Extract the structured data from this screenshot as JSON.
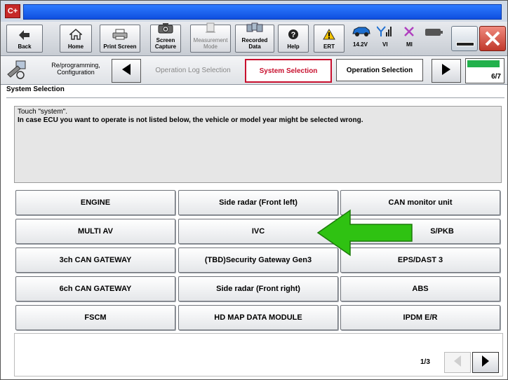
{
  "titlebar": {
    "app_icon_text": "C+"
  },
  "toolbar": {
    "back": "Back",
    "home": "Home",
    "print_screen": "Print Screen",
    "screen_capture": "Screen Capture",
    "measurement_mode": "Measurement Mode",
    "recorded_data": "Recorded Data",
    "help": "Help",
    "ert": "ERT",
    "voltage": "14.2V",
    "vi": "VI",
    "mi": "MI"
  },
  "nav": {
    "reprogramming": "Re/programming, Configuration",
    "step_operation_log": "Operation Log Selection",
    "step_system_selection": "System Selection",
    "step_operation_selection": "Operation Selection",
    "step_counter": "6/7"
  },
  "section": {
    "title": "System Selection",
    "instruction_1": "Touch \"system\".",
    "instruction_2": "In case ECU you want to operate is not listed below, the vehicle or model year might be selected wrong."
  },
  "systems": [
    [
      "ENGINE",
      "Side radar (Front left)",
      "CAN monitor unit"
    ],
    [
      "MULTI AV",
      "IVC",
      "S/PKB"
    ],
    [
      "3ch CAN GATEWAY",
      "(TBD)Security Gateway Gen3",
      "EPS/DAST 3"
    ],
    [
      "6ch CAN GATEWAY",
      "Side radar (Front right)",
      "ABS"
    ],
    [
      "FSCM",
      "HD MAP DATA MODULE",
      "IPDM E/R"
    ]
  ],
  "pager": {
    "page": "1/3"
  },
  "colors": {
    "highlight_arrow": "#2fc212",
    "title_blue": "#1a5ff0",
    "active_step": "#c8102e"
  }
}
